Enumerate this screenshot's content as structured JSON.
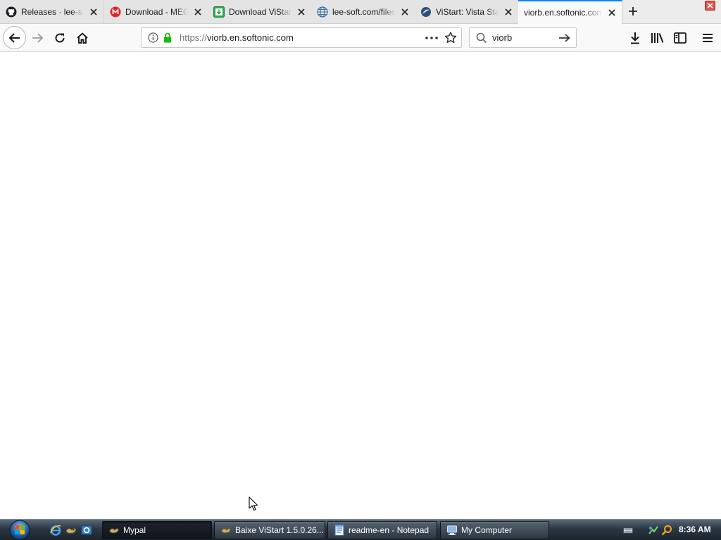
{
  "browser": {
    "tabs": [
      {
        "title": "Releases · lee-soft/ViStart",
        "icon": "github-icon",
        "active": false
      },
      {
        "title": "Download - MEGA",
        "icon": "mega-icon",
        "active": false
      },
      {
        "title": "Download ViStart",
        "icon": "download-site-icon",
        "active": false
      },
      {
        "title": "lee-soft.com/files",
        "icon": "globe-icon",
        "active": false
      },
      {
        "title": "ViStart: Vista Start Menu",
        "icon": "vistart-icon",
        "active": false
      },
      {
        "title": "viorb.en.softonic.com",
        "icon": "blank-page-icon",
        "active": true
      }
    ],
    "url": {
      "prefix": "https://",
      "host": "viorb.en.softonic.com"
    },
    "search": {
      "value": "viorb",
      "placeholder": "Search"
    }
  },
  "taskbar": {
    "quick_launch": [
      "internet-explorer-icon",
      "mypal-icon",
      "ie-alt-icon"
    ],
    "buttons": [
      {
        "label": "Mypal",
        "icon": "mypal-icon",
        "active": true
      },
      {
        "label": "Baixe ViStart 1.5.0.26...",
        "icon": "mypal-icon",
        "active": false
      },
      {
        "label": "readme-en - Notepad",
        "icon": "notepad-icon",
        "active": false
      },
      {
        "label": "My Computer",
        "icon": "computer-icon",
        "active": false
      }
    ],
    "clock": "8:36 AM"
  }
}
